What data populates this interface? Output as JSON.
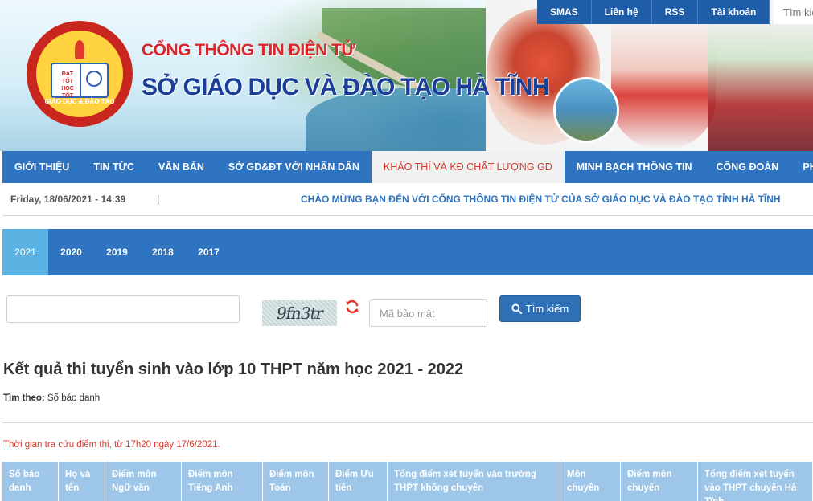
{
  "header": {
    "logo_top": "ĐẠT TỐT HỌC TỐT",
    "logo_ring": "GIÁO DỤC & ĐÀO TẠO",
    "title_sub": "CỔNG THÔNG TIN ĐIỆN TỬ",
    "title_main": "SỞ GIÁO DỤC VÀ ĐÀO TẠO HÀ TĨNH",
    "top_links": [
      "SMAS",
      "Liên hệ",
      "RSS",
      "Tài khoản"
    ],
    "search_placeholder": "Tìm kiếm"
  },
  "nav": {
    "items": [
      "GIỚI THIỆU",
      "TIN TỨC",
      "VĂN BẢN",
      "SỞ GD&ĐT VỚI NHÂN DÂN",
      "KHẢO THÍ VÀ KĐ CHẤT LƯỢNG GD",
      "MINH BẠCH THÔNG TIN",
      "CÔNG ĐOÀN",
      "PHẢN ÁNH"
    ],
    "active": "KHẢO THÍ VÀ KĐ CHẤT LƯỢNG GD"
  },
  "datebar": {
    "date": "Friday, 18/06/2021 - 14:39",
    "separator": "|",
    "welcome": "CHÀO MỪNG BẠN ĐẾN VỚI CỔNG THÔNG TIN ĐIỆN TỬ CỦA SỞ GIÁO DỤC VÀ ĐÀO TẠO TỈNH HÀ TĨNH"
  },
  "years": {
    "tabs": [
      "2021",
      "2020",
      "2019",
      "2018",
      "2017"
    ],
    "active": "2021"
  },
  "search": {
    "sbd_value": "",
    "captcha_text": "9fn3tr",
    "code_placeholder": "Mã bảo mật",
    "button_label": "Tìm kiếm"
  },
  "result": {
    "title": "Kết quả thi tuyển sinh vào lớp 10 THPT năm học 2021 - 2022",
    "search_by_label": "Tìm theo:",
    "search_by_value": "Số báo danh",
    "notice": "Thời gian tra cứu điểm thi, từ 17h20 ngày 17/6/2021."
  },
  "table": {
    "headers": [
      "Số báo danh",
      "Họ và tên",
      "Điểm môn Ngữ văn",
      "Điểm môn Tiếng Anh",
      "Điểm môn Toán",
      "Điểm Ưu tiên",
      "Tổng điểm xét tuyển vào trường THPT không chuyên",
      "Môn chuyên",
      "Điểm môn chuyên",
      "Tổng điểm xét tuyển vào THPT chuyên Hà Tĩnh"
    ]
  },
  "colors": {
    "primary_blue": "#2f74c0",
    "active_year": "#5bb3e3",
    "active_nav_text": "#d53a2f",
    "table_header": "#9dc6e8",
    "notice_red": "#d53a2f"
  }
}
